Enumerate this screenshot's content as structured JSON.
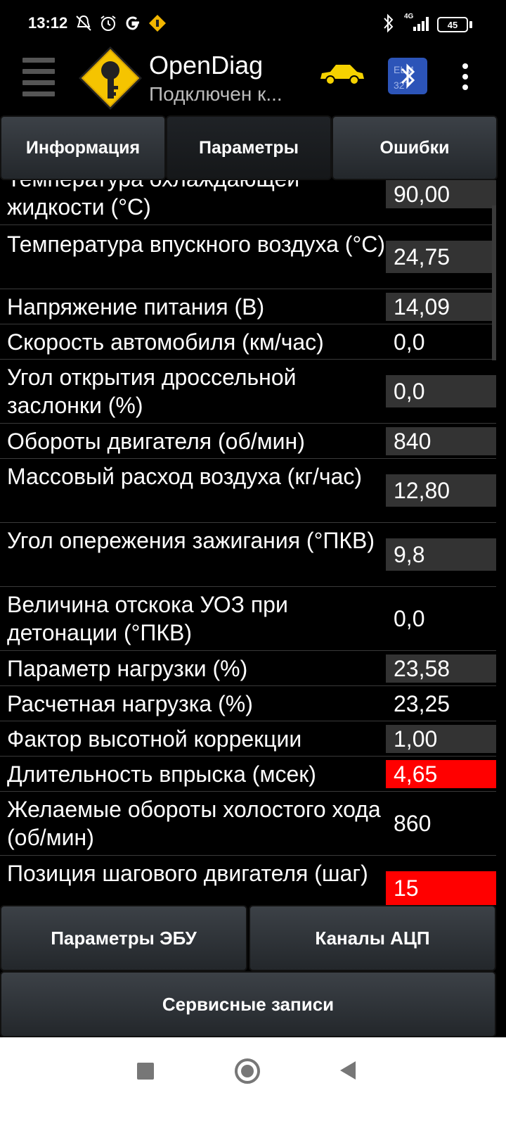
{
  "status_bar": {
    "time": "13:12",
    "icons_left": [
      "mute-icon",
      "alarm-icon",
      "google-icon",
      "maps-icon"
    ],
    "icons_right": [
      "bluetooth-icon",
      "signal-4g-icon",
      "battery-icon"
    ],
    "network_label": "4G",
    "battery_level": "45"
  },
  "action_bar": {
    "title": "OpenDiag",
    "subtitle": "Подключен к...",
    "icons": [
      "menu-icon",
      "app-logo-icon",
      "car-icon",
      "bluetooth-elm327-icon",
      "overflow-menu-icon"
    ],
    "car_color": "#f5d200"
  },
  "tabs": [
    {
      "label": "Информация",
      "active": false
    },
    {
      "label": "Параметры",
      "active": true
    },
    {
      "label": "Ошибки",
      "active": false
    }
  ],
  "params": [
    {
      "label": "Температура охлаждающей жидкости (°C)",
      "value": "90,00",
      "highlight": "gray"
    },
    {
      "label": "Температура впускного воздуха (°C)",
      "value": "24,75",
      "highlight": "gray"
    },
    {
      "label": "Напряжение питания (В)",
      "value": "14,09",
      "highlight": "gray"
    },
    {
      "label": "Скорость автомобиля (км/час)",
      "value": "0,0",
      "highlight": "none"
    },
    {
      "label": "Угол открытия дроссельной заслонки (%)",
      "value": "0,0",
      "highlight": "gray"
    },
    {
      "label": "Обороты двигателя (об/мин)",
      "value": "840",
      "highlight": "gray"
    },
    {
      "label": "Массовый расход воздуха (кг/час)",
      "value": "12,80",
      "highlight": "gray"
    },
    {
      "label": "Угол опережения зажигания (°ПКВ)",
      "value": "9,8",
      "highlight": "gray"
    },
    {
      "label": "Величина отскока УОЗ при детонации (°ПКВ)",
      "value": "0,0",
      "highlight": "none"
    },
    {
      "label": "Параметр нагрузки (%)",
      "value": "23,58",
      "highlight": "gray"
    },
    {
      "label": "Расчетная нагрузка (%)",
      "value": "23,25",
      "highlight": "none"
    },
    {
      "label": "Фактор высотной коррекции",
      "value": "1,00",
      "highlight": "gray"
    },
    {
      "label": "Длительность впрыска (мсек)",
      "value": "4,65",
      "highlight": "red"
    },
    {
      "label": "Желаемые обороты холостого хода (об/мин)",
      "value": "860",
      "highlight": "none"
    },
    {
      "label": "Позиция шагового двигателя (шаг)",
      "value": "15",
      "highlight": "red"
    }
  ],
  "bottom_buttons": {
    "ecu_params": "Параметры ЭБУ",
    "adc_channels": "Каналы АЦП",
    "service_records": "Сервисные записи"
  },
  "nav_bar": {
    "icons": [
      "recent-apps-icon",
      "home-icon",
      "back-icon"
    ]
  },
  "colors": {
    "background": "#000000",
    "value_gray": "#333333",
    "value_alert": "#ff0000",
    "row_divider": "#3a3a3a"
  }
}
